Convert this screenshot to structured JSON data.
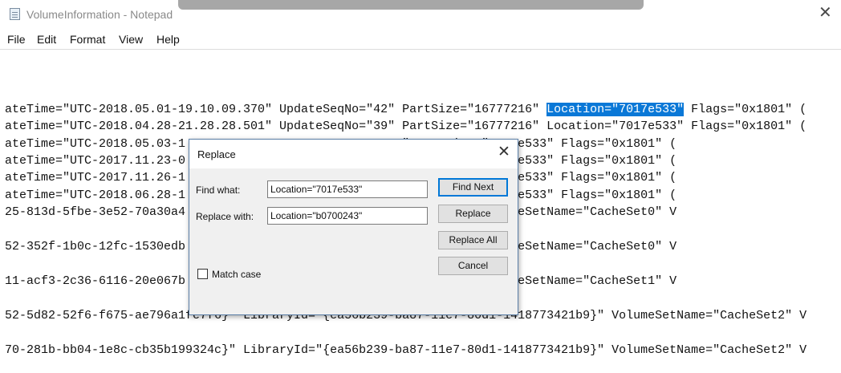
{
  "window": {
    "title": "VolumeInformation - Notepad",
    "close_glyph": "✕"
  },
  "menu": [
    "File",
    "Edit",
    "Format",
    "View",
    "Help"
  ],
  "editor": {
    "lines": [
      {
        "before": "ateTime=\"UTC-2018.05.01-19.10.09.370\" UpdateSeqNo=\"42\" PartSize=\"16777216\" ",
        "selected": "Location=\"7017e533\"",
        "after": " Flags=\"0x1801\" ("
      },
      {
        "before": "ateTime=\"UTC-2018.04.28-21.28.28.501\" UpdateSeqNo=\"39\" PartSize=\"16777216\" Location=\"7017e533\" Flags=\"0x1801\" ("
      },
      {
        "before": "ateTime=\"UTC-2018.05.03-1                         77216\" Location=\"7017e533\" Flags=\"0x1801\" ("
      },
      {
        "before": "ateTime=\"UTC-2017.11.23-0                         77216\" Location=\"7017e533\" Flags=\"0x1801\" ("
      },
      {
        "before": "ateTime=\"UTC-2017.11.26-1                         77216\" Location=\"7017e533\" Flags=\"0x1801\" ("
      },
      {
        "before": "ateTime=\"UTC-2018.06.28-1                         77216\" Location=\"7017e533\" Flags=\"0x1801\" ("
      },
      {
        "before": "25-813d-5fbe-3e52-70a30a4                         -1418773421b9}\" VolumeSetName=\"CacheSet0\" V"
      },
      {
        "before": "52-352f-1b0c-12fc-1530edb                         -1418773421b9}\" VolumeSetName=\"CacheSet0\" V"
      },
      {
        "before": "11-acf3-2c36-6116-20e067b                         -1418773421b9}\" VolumeSetName=\"CacheSet1\" V"
      },
      {
        "before": "52-5d82-52f6-f675-ae796a1fe7f6}\" LibraryId=\"{ea56b239-ba87-11e7-80d1-1418773421b9}\" VolumeSetName=\"CacheSet2\" V"
      },
      {
        "before": "70-281b-bb04-1e8c-cb35b199324c}\" LibraryId=\"{ea56b239-ba87-11e7-80d1-1418773421b9}\" VolumeSetName=\"CacheSet2\" V"
      }
    ]
  },
  "dialog": {
    "title": "Replace",
    "close_glyph": "✕",
    "find_label": "Find what:",
    "find_value": "Location=\"7017e533\"",
    "replace_label": "Replace with:",
    "replace_value": "Location=\"b0700243\"",
    "match_case_label": "Match case",
    "buttons": {
      "find_next": "Find Next",
      "replace": "Replace",
      "replace_all": "Replace All",
      "cancel": "Cancel"
    }
  }
}
